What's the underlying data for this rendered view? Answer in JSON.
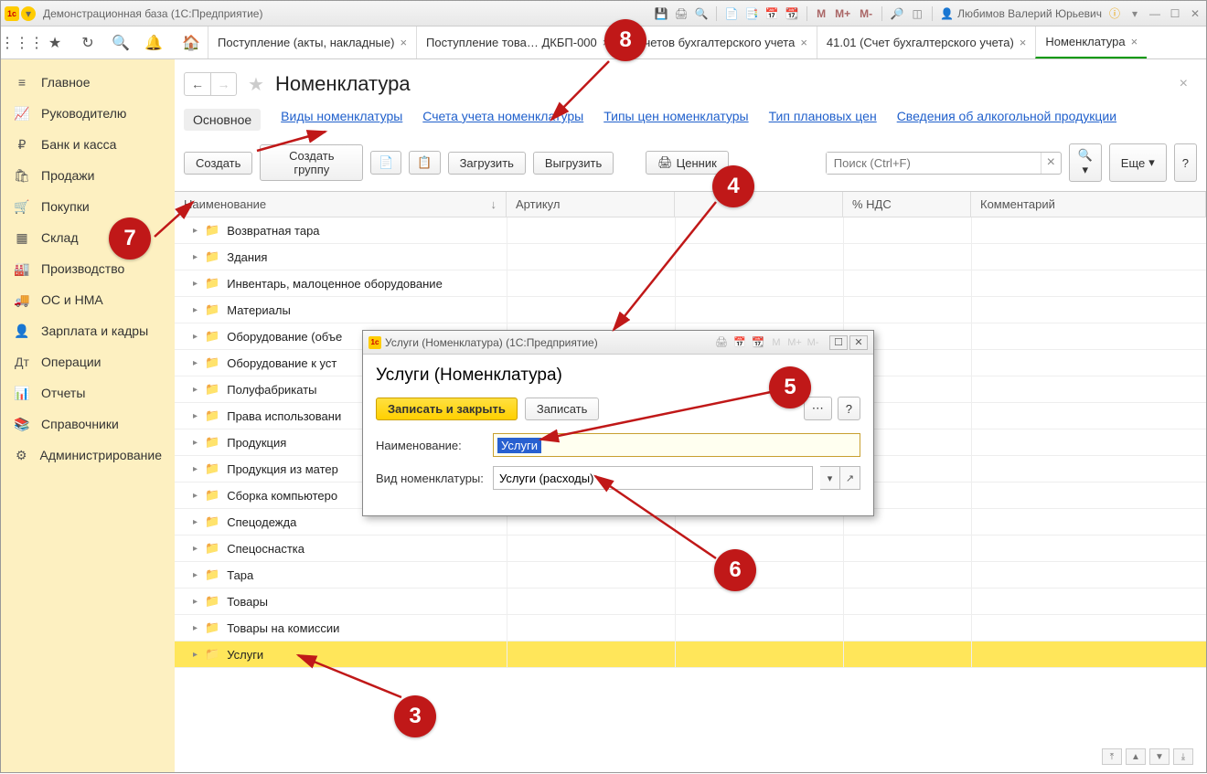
{
  "app": {
    "title": "Демонстрационная база  (1С:Предприятие)",
    "user": "Любимов Валерий Юрьевич"
  },
  "tabs": [
    {
      "label": "Поступление (акты, накладные)",
      "active": false
    },
    {
      "label": "Поступление това…  ДКБП-000",
      "active": false
    },
    {
      "label": "н счетов бухгалтерского учета",
      "active": false
    },
    {
      "label": "41.01 (Счет бухгалтерского учета)",
      "active": false
    },
    {
      "label": "Номенклатура",
      "active": true
    }
  ],
  "sidebar": {
    "items": [
      {
        "label": "Главное",
        "icon": "menu-icon"
      },
      {
        "label": "Руководителю",
        "icon": "chart-icon"
      },
      {
        "label": "Банк и касса",
        "icon": "ruble-icon"
      },
      {
        "label": "Продажи",
        "icon": "bag-icon"
      },
      {
        "label": "Покупки",
        "icon": "cart-icon"
      },
      {
        "label": "Склад",
        "icon": "warehouse-icon"
      },
      {
        "label": "Производство",
        "icon": "factory-icon"
      },
      {
        "label": "ОС и НМА",
        "icon": "truck-icon"
      },
      {
        "label": "Зарплата и кадры",
        "icon": "person-icon"
      },
      {
        "label": "Операции",
        "icon": "ops-icon"
      },
      {
        "label": "Отчеты",
        "icon": "bars-icon"
      },
      {
        "label": "Справочники",
        "icon": "book-icon"
      },
      {
        "label": "Администрирование",
        "icon": "gear-icon"
      }
    ]
  },
  "page": {
    "title": "Номенклатура",
    "subnav": [
      {
        "label": "Основное",
        "active": true
      },
      {
        "label": "Виды номенклатуры"
      },
      {
        "label": "Счета учета номенклатуры"
      },
      {
        "label": "Типы цен номенклатуры"
      },
      {
        "label": "Тип плановых цен"
      },
      {
        "label": "Сведения об алкогольной продукции"
      }
    ],
    "toolbar": {
      "create": "Создать",
      "create_group": "Создать группу",
      "load": "Загрузить",
      "unload": "Выгрузить",
      "price_tags": "Ценник",
      "search_placeholder": "Поиск (Ctrl+F)",
      "more": "Еще",
      "help": "?"
    },
    "columns": {
      "name": "Наименование",
      "article": "Артикул",
      "nds": "% НДС",
      "comment": "Комментарий"
    },
    "rows": [
      {
        "name": "Возвратная тара"
      },
      {
        "name": "Здания"
      },
      {
        "name": "Инвентарь, малоценное оборудование"
      },
      {
        "name": "Материалы"
      },
      {
        "name": "Оборудование (объе"
      },
      {
        "name": "Оборудование к уст"
      },
      {
        "name": "Полуфабрикаты"
      },
      {
        "name": "Права использовани"
      },
      {
        "name": "Продукция"
      },
      {
        "name": "Продукция из матер"
      },
      {
        "name": "Сборка компьютеро"
      },
      {
        "name": "Спецодежда"
      },
      {
        "name": "Спецоснастка"
      },
      {
        "name": "Тара"
      },
      {
        "name": "Товары"
      },
      {
        "name": "Товары на комиссии"
      },
      {
        "name": "Услуги",
        "selected": true
      }
    ]
  },
  "modal": {
    "title": "Услуги (Номенклатура)  (1С:Предприятие)",
    "heading": "Услуги (Номенклатура)",
    "save_close": "Записать и закрыть",
    "save": "Записать",
    "help": "?",
    "name_label": "Наименование:",
    "name_value": "Услуги",
    "kind_label": "Вид номенклатуры:",
    "kind_value": "Услуги (расходы)"
  },
  "callouts": {
    "c3": "3",
    "c4": "4",
    "c5": "5",
    "c6": "6",
    "c7": "7",
    "c8": "8"
  }
}
